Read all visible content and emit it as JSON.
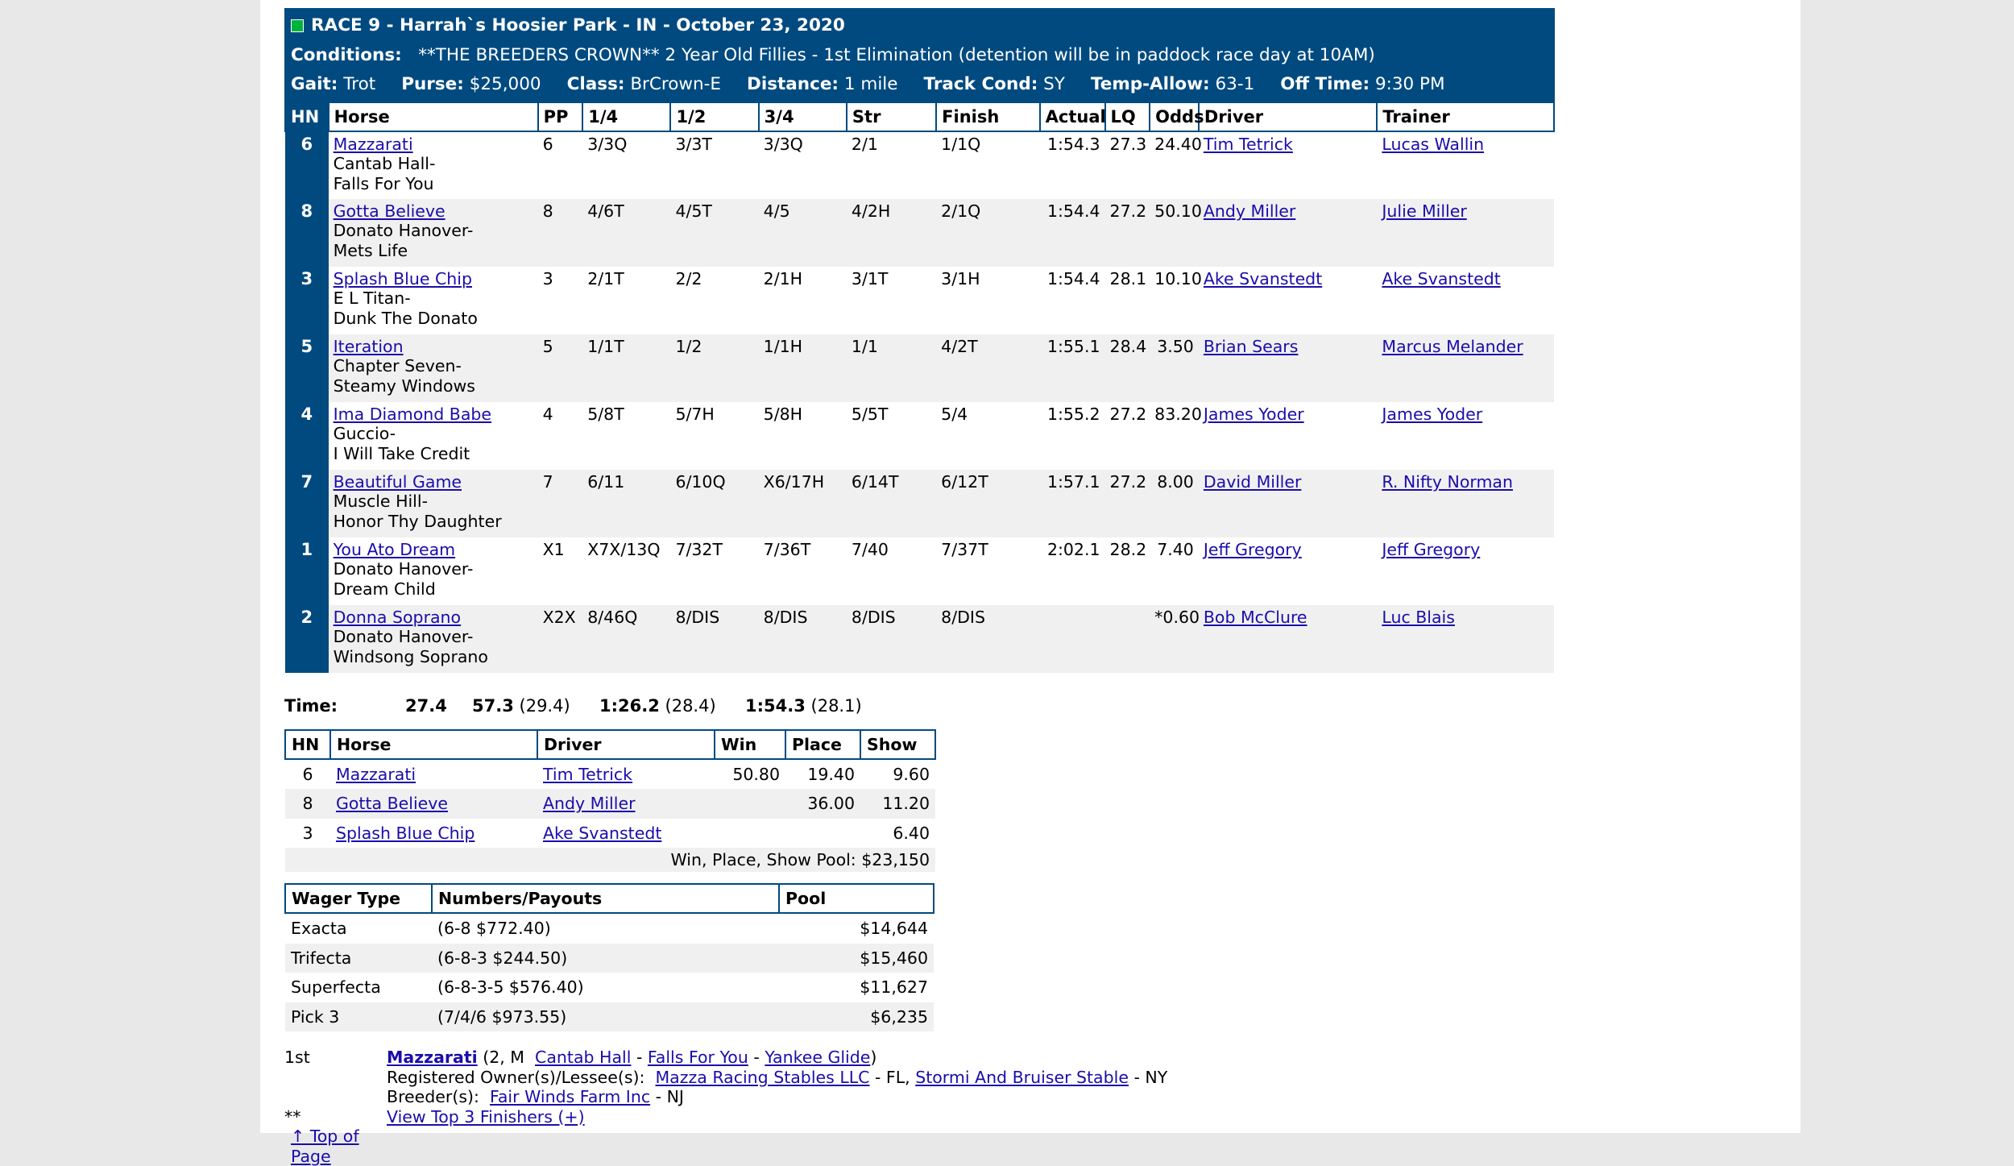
{
  "race": {
    "title": "RACE 9 - Harrah`s Hoosier Park - IN - October 23, 2020",
    "conditions_label": "Conditions:",
    "conditions": "**THE BREEDERS CROWN** 2 Year Old Fillies - 1st Elimination (detention will be in paddock race day at 10AM)",
    "gait_label": "Gait:",
    "gait": "Trot",
    "purse_label": "Purse:",
    "purse": "$25,000",
    "class_label": "Class:",
    "class": "BrCrown-E",
    "distance_label": "Distance:",
    "distance": "1 mile",
    "track_label": "Track Cond:",
    "track": "SY",
    "temp_label": "Temp-Allow:",
    "temp": "63-1",
    "off_label": "Off Time:",
    "off": "9:30 PM"
  },
  "results_headers": [
    "HN",
    "Horse",
    "PP",
    "1/4",
    "1/2",
    "3/4",
    "Str",
    "Finish",
    "Actual",
    "LQ",
    "Odds",
    "Driver",
    "Trainer"
  ],
  "results": [
    {
      "hn": "6",
      "horse": "Mazzarati",
      "sire": "Cantab Hall-",
      "dam": "Falls For You",
      "pp": "6",
      "q1": "3/3Q",
      "q2": "3/3T",
      "q3": "3/3Q",
      "str": "2/1",
      "fin": "1/1Q",
      "actual": "1:54.3",
      "lq": "27.3",
      "odds": "24.40",
      "driver": "Tim Tetrick",
      "trainer": "Lucas Wallin"
    },
    {
      "hn": "8",
      "horse": "Gotta Believe",
      "sire": "Donato Hanover-",
      "dam": "Mets Life",
      "pp": "8",
      "q1": "4/6T",
      "q2": "4/5T",
      "q3": "4/5",
      "str": "4/2H",
      "fin": "2/1Q",
      "actual": "1:54.4",
      "lq": "27.2",
      "odds": "50.10",
      "driver": "Andy Miller",
      "trainer": "Julie Miller"
    },
    {
      "hn": "3",
      "horse": "Splash Blue Chip",
      "sire": "E L Titan-",
      "dam": "Dunk The Donato",
      "pp": "3",
      "q1": "2/1T",
      "q2": "2/2",
      "q3": "2/1H",
      "str": "3/1T",
      "fin": "3/1H",
      "actual": "1:54.4",
      "lq": "28.1",
      "odds": "10.10",
      "driver": "Ake Svanstedt",
      "trainer": "Ake Svanstedt"
    },
    {
      "hn": "5",
      "horse": "Iteration",
      "sire": "Chapter Seven-",
      "dam": "Steamy Windows",
      "pp": "5",
      "q1": "1/1T",
      "q2": "1/2",
      "q3": "1/1H",
      "str": "1/1",
      "fin": "4/2T",
      "actual": "1:55.1",
      "lq": "28.4",
      "odds": "3.50",
      "driver": "Brian Sears",
      "trainer": "Marcus Melander"
    },
    {
      "hn": "4",
      "horse": "Ima Diamond Babe",
      "sire": "Guccio-",
      "dam": "I Will Take Credit",
      "pp": "4",
      "q1": "5/8T",
      "q2": "5/7H",
      "q3": "5/8H",
      "str": "5/5T",
      "fin": "5/4",
      "actual": "1:55.2",
      "lq": "27.2",
      "odds": "83.20",
      "driver": "James Yoder",
      "trainer": "James Yoder"
    },
    {
      "hn": "7",
      "horse": "Beautiful Game",
      "sire": "Muscle Hill-",
      "dam": "Honor Thy Daughter",
      "pp": "7",
      "q1": "6/11",
      "q2": "6/10Q",
      "q3": "X6/17H",
      "str": "6/14T",
      "fin": "6/12T",
      "actual": "1:57.1",
      "lq": "27.2",
      "odds": "8.00",
      "driver": "David Miller",
      "trainer": "R. Nifty Norman"
    },
    {
      "hn": "1",
      "horse": "You Ato Dream",
      "sire": "Donato Hanover-",
      "dam": "Dream Child",
      "pp": "X1",
      "q1": "X7X/13Q",
      "q2": "7/32T",
      "q3": "7/36T",
      "str": "7/40",
      "fin": "7/37T",
      "actual": "2:02.1",
      "lq": "28.2",
      "odds": "7.40",
      "driver": "Jeff Gregory",
      "trainer": "Jeff Gregory"
    },
    {
      "hn": "2",
      "horse": "Donna Soprano",
      "sire": "Donato Hanover-",
      "dam": "Windsong Soprano",
      "pp": "X2X",
      "q1": "8/46Q",
      "q2": "8/DIS",
      "q3": "8/DIS",
      "str": "8/DIS",
      "fin": "8/DIS",
      "actual": "",
      "lq": "",
      "odds": "*0.60",
      "driver": "Bob McClure",
      "trainer": "Luc Blais"
    }
  ],
  "times": {
    "label": "Time:",
    "t1": "27.4",
    "t2": "57.3",
    "t2s": "(29.4)",
    "t3": "1:26.2",
    "t3s": "(28.4)",
    "t4": "1:54.3",
    "t4s": "(28.1)"
  },
  "payout_headers": [
    "HN",
    "Horse",
    "Driver",
    "Win",
    "Place",
    "Show"
  ],
  "payouts": [
    {
      "hn": "6",
      "horse": "Mazzarati",
      "driver": "Tim Tetrick",
      "win": "50.80",
      "place": "19.40",
      "show": "9.60"
    },
    {
      "hn": "8",
      "horse": "Gotta Believe",
      "driver": "Andy Miller",
      "win": "",
      "place": "36.00",
      "show": "11.20"
    },
    {
      "hn": "3",
      "horse": "Splash Blue Chip",
      "driver": "Ake Svanstedt",
      "win": "",
      "place": "",
      "show": "6.40"
    }
  ],
  "wps_pool": "Win, Place, Show Pool: $23,150",
  "wager_headers": [
    "Wager Type",
    "Numbers/Payouts",
    "Pool"
  ],
  "wagers": [
    {
      "type": "Exacta",
      "payout": "(6-8 $772.40)",
      "pool": "$14,644"
    },
    {
      "type": "Trifecta",
      "payout": "(6-8-3 $244.50)",
      "pool": "$15,460"
    },
    {
      "type": "Superfecta",
      "payout": "(6-8-3-5 $576.40)",
      "pool": "$11,627"
    },
    {
      "type": "Pick 3",
      "payout": "(7/4/6 $973.55)",
      "pool": "$6,235"
    }
  ],
  "winner": {
    "place": "1st",
    "horse": "Mazzarati",
    "info_open": "(2, M",
    "sire": "Cantab Hall",
    "dash1": "-",
    "dam": "Falls For You",
    "dash2": "-",
    "damsire": "Yankee Glide",
    "info_close": ")",
    "owner_label": "Registered Owner(s)/Lessee(s):",
    "owner1": "Mazza Racing Stables LLC",
    "owner1_state": "- FL,",
    "owner2": "Stormi And Bruiser Stable",
    "owner2_state": "- NY",
    "breeder_label": "Breeder(s):",
    "breeder": "Fair Winds Farm Inc",
    "breeder_state": "- NJ",
    "stars": "**",
    "top3_link": "View Top 3 Finishers (+)",
    "top_link": "↑ Top of Page"
  }
}
